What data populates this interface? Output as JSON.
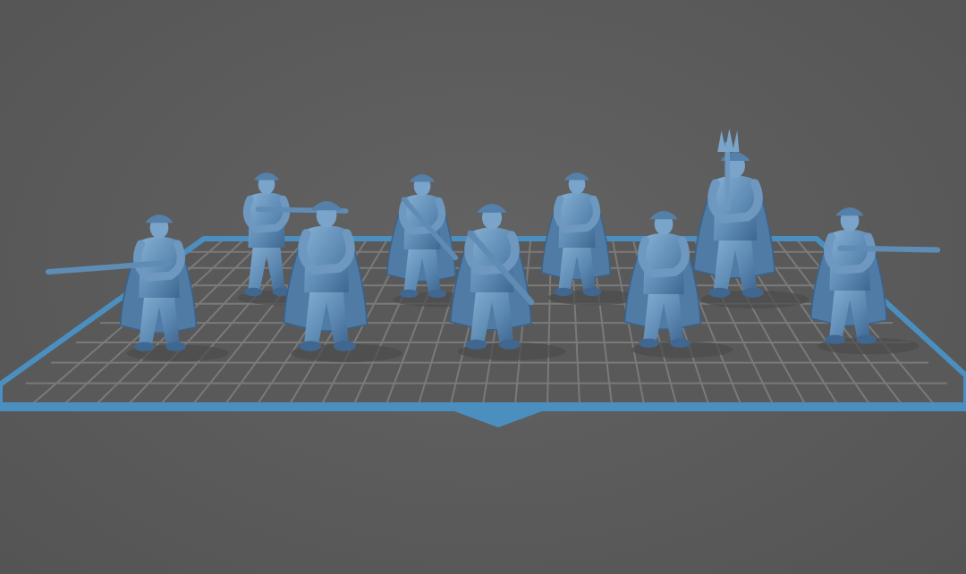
{
  "viewport": {
    "background_color": "#5b5b5b",
    "build_plate_fill": "#595959",
    "build_plate_grid_color": "#7a7a7a",
    "build_plate_border_color": "#4a8fc0",
    "model_color": "#5f8cb5",
    "model_highlight": "#86afd3",
    "model_shadow": "#3f6790"
  },
  "models": [
    {
      "name": "soldier-aiming-rifle-left",
      "pose": "aiming-rifle"
    },
    {
      "name": "soldier-with-rifle-back",
      "pose": "holding-rifle"
    },
    {
      "name": "soldier-in-cape-front",
      "pose": "holding-pistol"
    },
    {
      "name": "soldier-with-rifle-diagonal",
      "pose": "rifle-diagonal"
    },
    {
      "name": "soldier-with-rifle-center",
      "pose": "rifle-diagonal"
    },
    {
      "name": "soldier-in-cape-back",
      "pose": "standing"
    },
    {
      "name": "soldier-in-cape-right",
      "pose": "walking"
    },
    {
      "name": "soldier-with-banner",
      "pose": "banner"
    },
    {
      "name": "soldier-aiming-rifle-right",
      "pose": "aiming-rifle"
    }
  ]
}
